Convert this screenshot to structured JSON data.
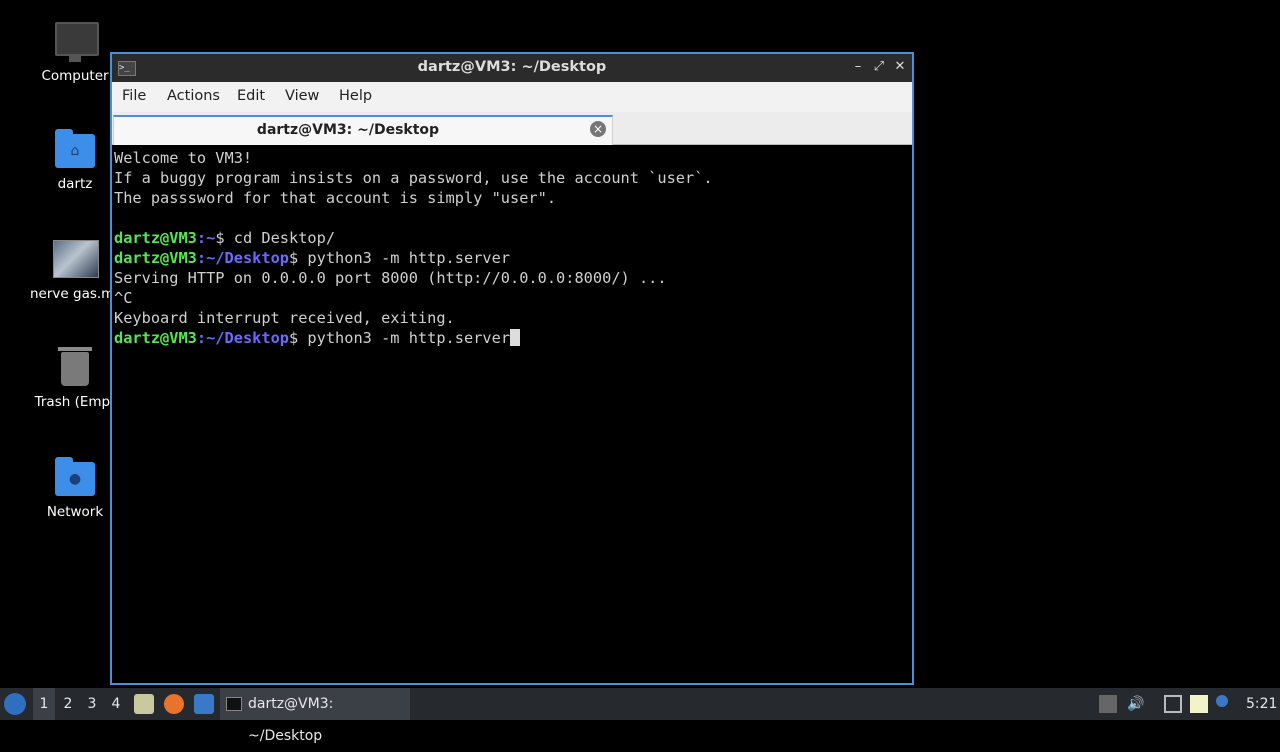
{
  "desktop": {
    "icons": [
      {
        "label": "Computer",
        "icon": "computer-icon"
      },
      {
        "label": "dartz",
        "icon": "home-folder-icon"
      },
      {
        "label": "nerve gas.mp",
        "icon": "video-thumbnail-icon"
      },
      {
        "label": "Trash (Empt",
        "icon": "trash-icon"
      },
      {
        "label": "Network",
        "icon": "network-folder-icon"
      }
    ]
  },
  "window": {
    "title": "dartz@VM3: ~/Desktop",
    "menu": [
      "File",
      "Actions",
      "Edit",
      "View",
      "Help"
    ],
    "tab_label": "dartz@VM3: ~/Desktop",
    "terminal": {
      "welcome": "Welcome to VM3!",
      "info1": "If a buggy program insists on a password, use the account `user`.",
      "info2": "The passsword for that account is simply \"user\".",
      "user_host": "dartz@VM3",
      "home_path": ":~",
      "desktop_path": ":~/Desktop",
      "cmd1": "$ cd Desktop/",
      "cmd2": "$ python3 -m http.server",
      "serving": "Serving HTTP on 0.0.0.0 port 8000 (http://0.0.0.0:8000/) ...",
      "ctrl_c": "^C",
      "interrupt": "Keyboard interrupt received, exiting.",
      "cmd3": "$ python3 -m http.server"
    }
  },
  "taskbar": {
    "workspaces": [
      "1",
      "2",
      "3",
      "4"
    ],
    "active_workspace": "1",
    "task_label": "dartz@VM3: ~/Desktop",
    "clock": "5:21"
  }
}
